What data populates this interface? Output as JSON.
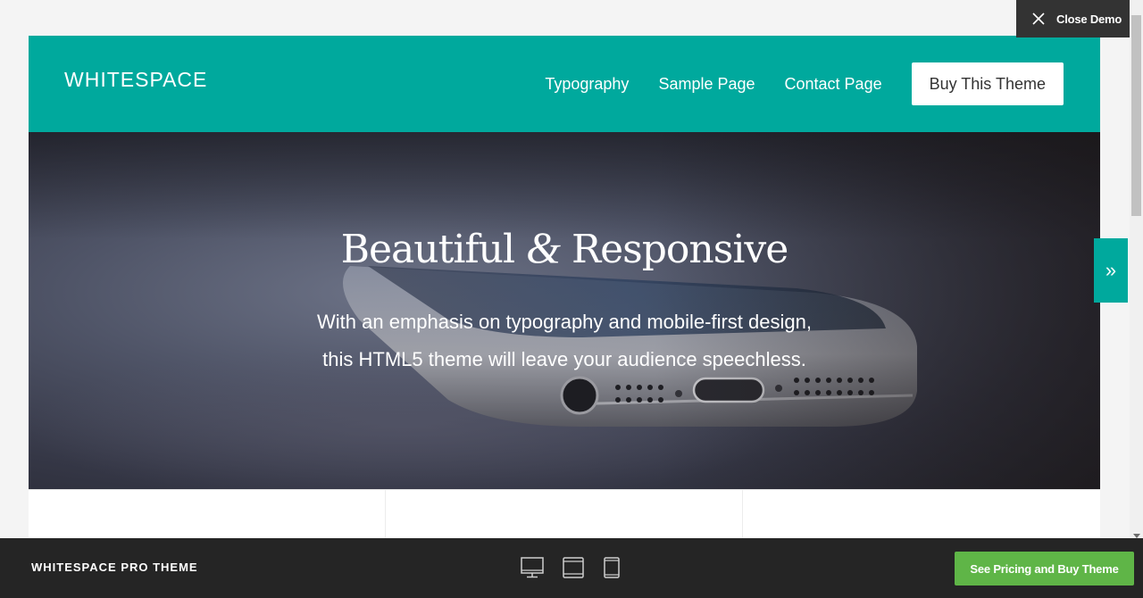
{
  "demo": {
    "close_label": "Close Demo"
  },
  "site": {
    "logo": "WHITESPACE",
    "nav": {
      "items": [
        "Typography",
        "Sample Page",
        "Contact Page"
      ],
      "buy_label": "Buy This Theme"
    },
    "hero": {
      "title_before": "Beautiful",
      "title_amp": "&",
      "title_after": "Responsive",
      "subtitle_line1": "With an emphasis on typography and mobile-first design,",
      "subtitle_line2": "this HTML5 theme will leave your audience speechless."
    }
  },
  "side_tab": {
    "glyph": "»"
  },
  "bottom_bar": {
    "title": "WHITESPACE PRO THEME",
    "devices": [
      "desktop-icon",
      "tablet-landscape-icon",
      "tablet-portrait-icon"
    ],
    "pricing_label": "See Pricing and Buy Theme"
  },
  "colors": {
    "brand_teal": "#00a99d",
    "buy_green": "#5fb547",
    "bar_dark": "#252525"
  }
}
